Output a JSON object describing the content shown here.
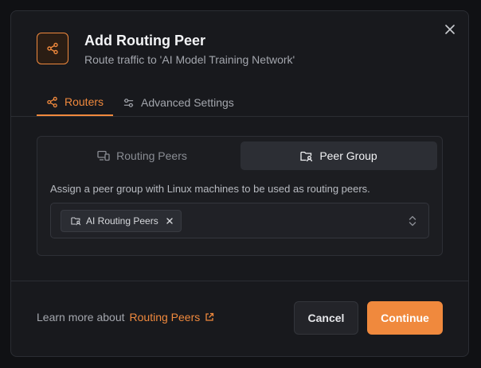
{
  "dialog": {
    "title": "Add Routing Peer",
    "subtitle": "Route traffic to 'AI Model Training Network'"
  },
  "tabs": [
    {
      "label": "Routers",
      "icon": "share-nodes-icon",
      "active": true
    },
    {
      "label": "Advanced Settings",
      "icon": "sliders-icon",
      "active": false
    }
  ],
  "segmented": [
    {
      "label": "Routing Peers",
      "icon": "devices-icon",
      "active": false
    },
    {
      "label": "Peer Group",
      "icon": "folder-group-icon",
      "active": true
    }
  ],
  "panel": {
    "description": "Assign a peer group with Linux machines to be used as routing peers.",
    "selected_chip": "AI Routing Peers"
  },
  "footer": {
    "learn_prefix": "Learn more about",
    "learn_link": "Routing Peers",
    "cancel_label": "Cancel",
    "continue_label": "Continue"
  },
  "colors": {
    "accent": "#f0893d",
    "background": "#18191d"
  }
}
